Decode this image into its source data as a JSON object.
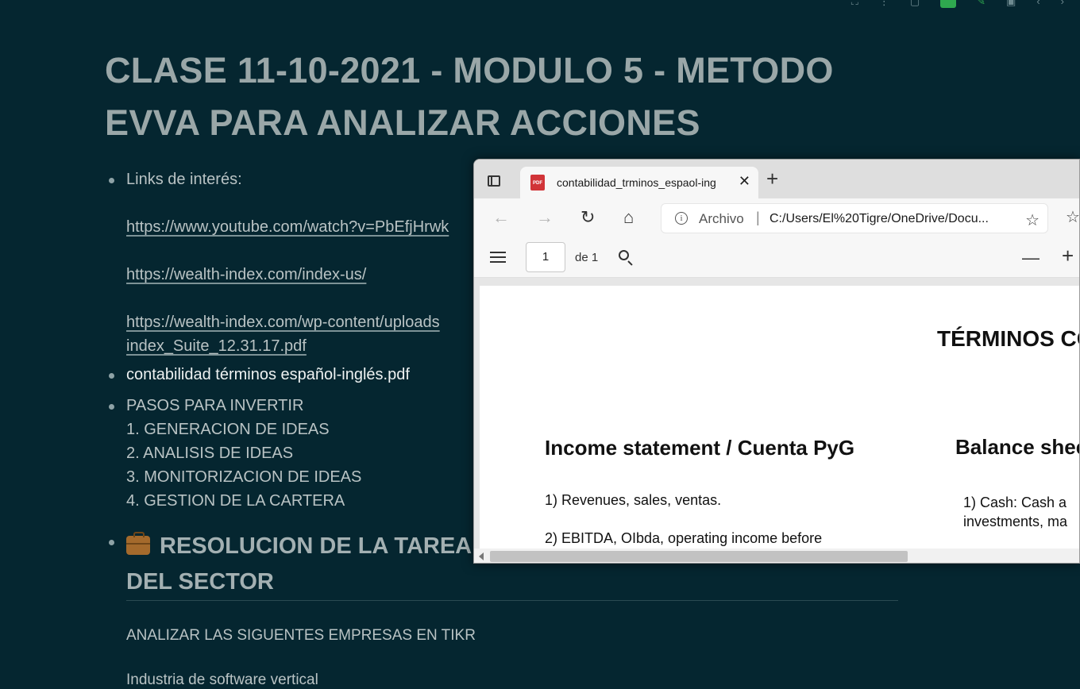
{
  "note": {
    "title": "CLASE 11-10-2021 - MODULO 5 - METODO EVVA PARA ANALIZAR ACCIONES",
    "links_label": "Links de interés:",
    "link1": "https://www.youtube.com/watch?v=PbEfjHrwk",
    "link2": "https://wealth-index.com/index-us/",
    "link3_line1": "https://wealth-index.com/wp-content/uploads",
    "link3_line2": "index_Suite_12.31.17.pdf",
    "attachment": "contabilidad términos español-inglés.pdf",
    "steps_title": "PASOS PARA INVERTIR",
    "steps": [
      "1. GENERACION DE IDEAS",
      "2. ANALISIS DE IDEAS",
      "3. MONITORIZACION DE IDEAS",
      "4. GESTION DE LA CARTERA"
    ],
    "section_heading_line1": "RESOLUCION DE LA TAREA",
    "section_heading_line2": "DEL SECTOR",
    "analyze_text": "ANALIZAR LAS SIGUENTES EMPRESAS EN TIKR",
    "industry_text": "Industria de software vertical"
  },
  "browser": {
    "tab_title": "contabilidad_trminos_espaol-ing",
    "address_label": "Archivo",
    "address_sep": "|",
    "address_url": "C:/Users/El%20Tigre/OneDrive/Docu...",
    "page_number": "1",
    "page_of": "de 1"
  },
  "pdf": {
    "title": "TÉRMINOS CO",
    "heading_left": "Income statement / Cuenta PyG",
    "heading_right": "Balance shee",
    "item1": "1)  Revenues,  sales,  ventas.",
    "item2": "2)  EBITDA, OIbda, operating income before",
    "right_item1_line1": "1) Cash:  Cash a",
    "right_item1_line2": "investments, ma"
  },
  "icons": {
    "pdf_tab": "pdf-file-icon",
    "close": "close-icon",
    "new_tab": "plus-icon",
    "back": "back-arrow-icon",
    "forward": "forward-arrow-icon",
    "refresh": "refresh-icon",
    "home": "home-icon",
    "info": "info-icon",
    "add_favorite": "add-favorite-icon",
    "favorites": "favorites-star-icon",
    "contents": "table-of-contents-icon",
    "search": "search-icon",
    "zoom_out": "minus-icon",
    "zoom_in": "plus-icon",
    "briefcase": "briefcase-emoji-icon"
  },
  "colors": {
    "note_background": "#052630",
    "pdf_badge": "#d13438",
    "toolbar_accent": "#2fa84f"
  }
}
